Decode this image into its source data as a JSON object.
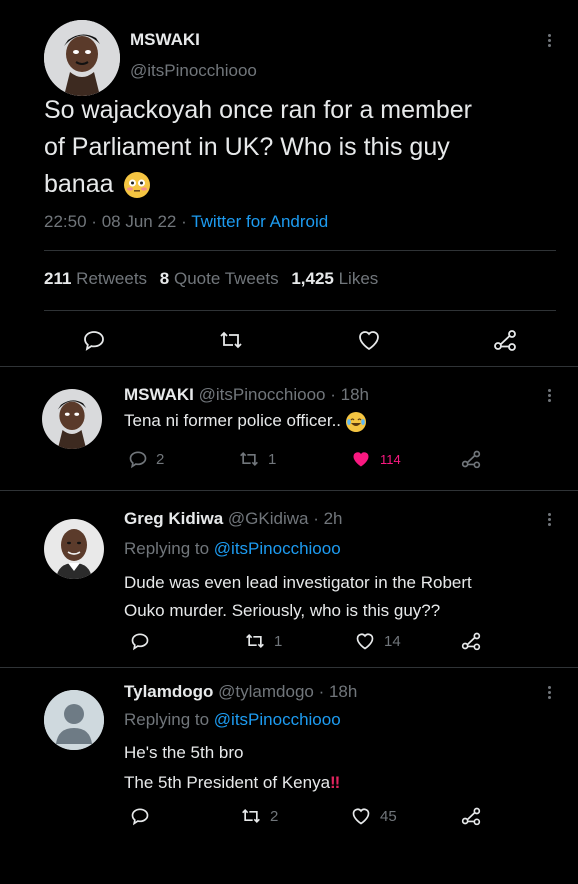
{
  "main_tweet": {
    "display_name": "MSWAKI",
    "handle": "@itsPinocchiooo",
    "text_line1": "So wajackoyah once ran for a member",
    "text_line2": "of Parliament in UK? Who is this guy",
    "text_line3": "banaa",
    "time": "22:50",
    "sep1": "·",
    "date": "08 Jun 22",
    "sep2": "·",
    "source": "Twitter for Android",
    "retweets_count": "211",
    "retweets_label": "Retweets",
    "quotes_count": "8",
    "quotes_label": "Quote Tweets",
    "likes_count": "1,425",
    "likes_label": "Likes"
  },
  "replies": [
    {
      "display_name": "MSWAKI",
      "handle": "@itsPinocchiooo",
      "time": "· 18h",
      "text": "Tena ni former police officer..",
      "reply_count": "2",
      "retweet_count": "1",
      "like_count": "114"
    },
    {
      "display_name": "Greg Kidiwa",
      "handle": "@GKidiwa",
      "time": "· 2h",
      "replying_label": "Replying to",
      "replying_to": "@itsPinocchiooo",
      "text_line1": "Dude was even lead investigator in the Robert",
      "text_line2": "Ouko murder. Seriously, who is this guy??",
      "retweet_count": "1",
      "like_count": "14"
    },
    {
      "display_name": "Tylamdogo",
      "handle": "@tylamdogo",
      "time": "· 18h",
      "replying_label": "Replying to",
      "replying_to": "@itsPinocchiooo",
      "text_line1": "He's the 5th bro",
      "text_line2": "The 5th President of Kenya",
      "text_line2_suffix": "‼",
      "retweet_count": "2",
      "like_count": "45"
    }
  ],
  "icons": {
    "reply": "reply-icon",
    "retweet": "retweet-icon",
    "like": "heart-icon",
    "share": "share-icon",
    "more": "more-icon",
    "flushed_face": "flushed-face-emoji",
    "laughing_face": "tears-of-joy-emoji"
  },
  "colors": {
    "background": "#000000",
    "text": "#e7e9ea",
    "muted": "#71767b",
    "link": "#1d9bf0",
    "like": "#f91880"
  }
}
